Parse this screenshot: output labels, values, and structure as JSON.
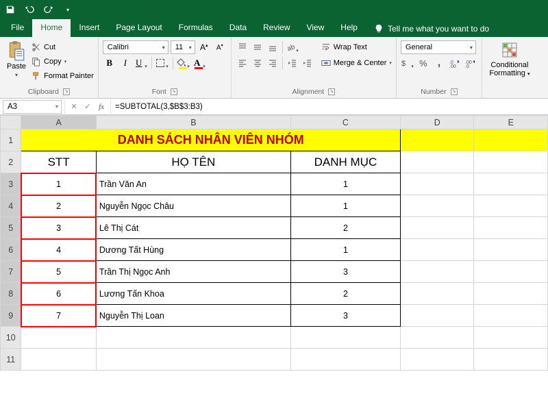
{
  "tabs": {
    "file": "File",
    "home": "Home",
    "insert": "Insert",
    "pagelayout": "Page Layout",
    "formulas": "Formulas",
    "data": "Data",
    "review": "Review",
    "view": "View",
    "help": "Help",
    "tellme": "Tell me what you want to do"
  },
  "clipboard": {
    "paste": "Paste",
    "cut": "Cut",
    "copy": "Copy",
    "format_painter": "Format Painter",
    "label": "Clipboard"
  },
  "font": {
    "name": "Calibri",
    "size": "11",
    "label": "Font",
    "bold": "B",
    "italic": "I",
    "underline": "U",
    "fontcolor": "A"
  },
  "alignment": {
    "wrap": "Wrap Text",
    "merge": "Merge & Center",
    "label": "Alignment"
  },
  "number": {
    "format": "General",
    "label": "Number"
  },
  "styles": {
    "cond_fmt1": "Conditional",
    "cond_fmt2": "Formatting"
  },
  "namebox": "A3",
  "formula": "=SUBTOTAL(3,$B$3:B3)",
  "cols": {
    "A": "A",
    "B": "B",
    "C": "C",
    "D": "D",
    "E": "E"
  },
  "rowlabels": [
    "1",
    "2",
    "3",
    "4",
    "5",
    "6",
    "7",
    "8",
    "9",
    "10",
    "11"
  ],
  "sheet": {
    "title": "DANH SÁCH NHÂN VIÊN NHÓM",
    "h_stt": "STT",
    "h_name": "HỌ TÊN",
    "h_cat": "DANH MỤC",
    "rows": [
      {
        "stt": "1",
        "name": "Trần Văn An",
        "cat": "1"
      },
      {
        "stt": "2",
        "name": "Nguyễn Ngọc Châu",
        "cat": "1"
      },
      {
        "stt": "3",
        "name": "Lê Thị Cát",
        "cat": "2"
      },
      {
        "stt": "4",
        "name": "Dương Tất Hùng",
        "cat": "1"
      },
      {
        "stt": "5",
        "name": "Trần Thị Ngọc Anh",
        "cat": "3"
      },
      {
        "stt": "6",
        "name": "Lương Tấn Khoa",
        "cat": "2"
      },
      {
        "stt": "7",
        "name": "Nguyễn Thị Loan",
        "cat": "3"
      }
    ]
  }
}
